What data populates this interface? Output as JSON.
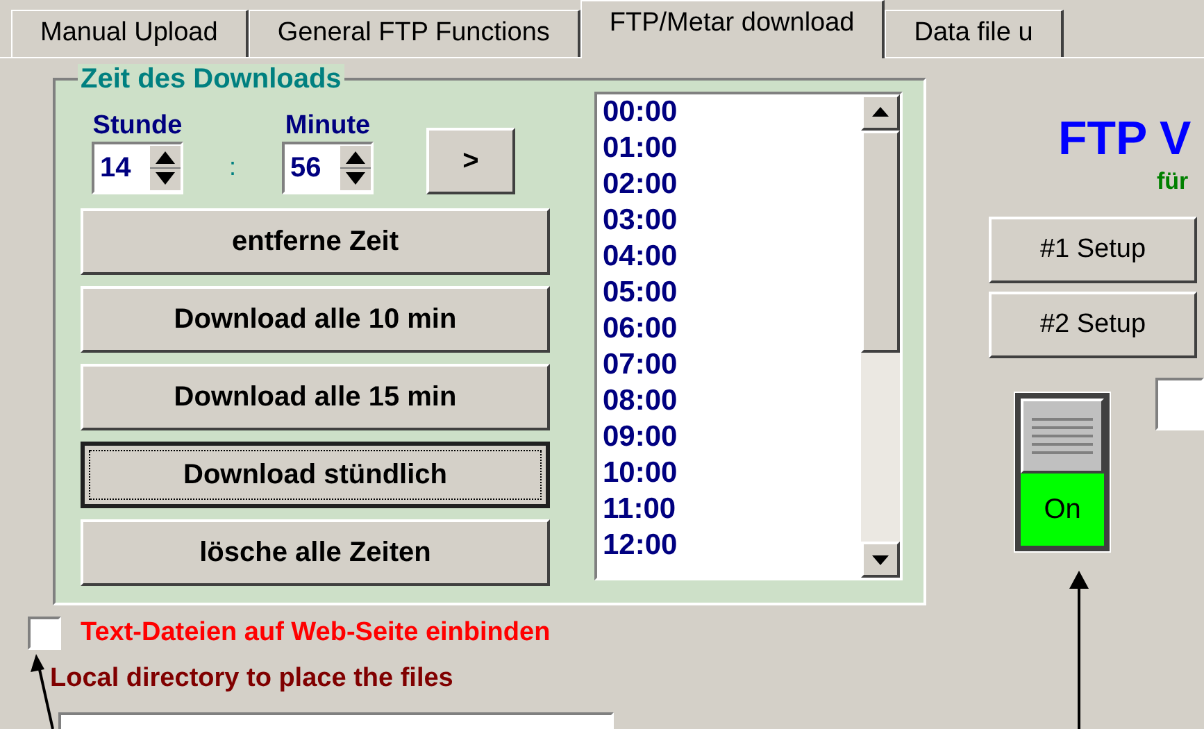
{
  "tabs": [
    {
      "label": "Manual Upload",
      "selected": false
    },
    {
      "label": "General FTP Functions",
      "selected": false
    },
    {
      "label": "FTP/Metar download",
      "selected": true
    },
    {
      "label": "Data file u",
      "selected": false
    }
  ],
  "download_time": {
    "title": "Zeit des Downloads",
    "hour_label": "Stunde",
    "minute_label": "Minute",
    "hour": "14",
    "separator": ":",
    "minute": "56",
    "add_button": ">",
    "buttons": [
      {
        "label": "entferne Zeit",
        "focused": false
      },
      {
        "label": "Download alle 10 min",
        "focused": false
      },
      {
        "label": "Download alle 15 min",
        "focused": false
      },
      {
        "label": "Download stündlich",
        "focused": true
      },
      {
        "label": "lösche alle Zeiten",
        "focused": false
      }
    ],
    "times": [
      "00:00",
      "01:00",
      "02:00",
      "03:00",
      "04:00",
      "05:00",
      "06:00",
      "07:00",
      "08:00",
      "09:00",
      "10:00",
      "11:00",
      "12:00"
    ]
  },
  "embed_checkbox": {
    "label": "Text-Dateien auf Web-Seite einbinden",
    "checked": false
  },
  "directory_label": "Local directory to place the files",
  "right": {
    "title": "FTP V",
    "subtitle": "für",
    "setup_buttons": [
      "#1 Setup",
      "#2 Setup"
    ],
    "toggle": {
      "label": "On",
      "on": true
    }
  }
}
